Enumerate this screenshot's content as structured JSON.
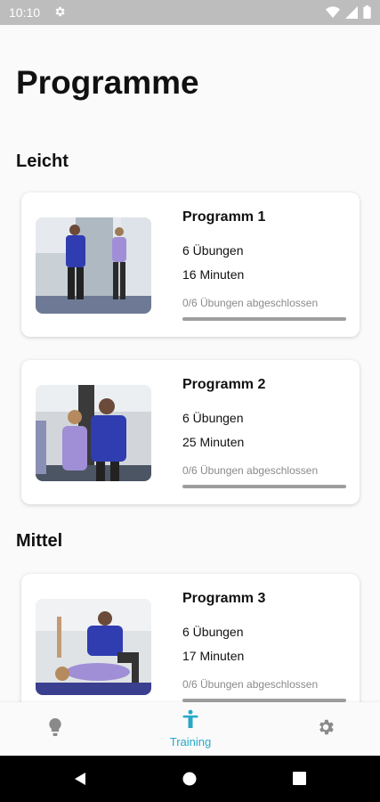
{
  "status_bar": {
    "time": "10:10"
  },
  "page": {
    "title": "Programme"
  },
  "sections": [
    {
      "label": "Leicht"
    },
    {
      "label": "Mittel"
    }
  ],
  "programs": [
    {
      "title": "Programm 1",
      "exercises": "6 Übungen",
      "duration": "16 Minuten",
      "progress_text": "0/6 Übungen abgeschlossen",
      "progress": 0
    },
    {
      "title": "Programm 2",
      "exercises": "6 Übungen",
      "duration": "25 Minuten",
      "progress_text": "0/6 Übungen abgeschlossen",
      "progress": 0
    },
    {
      "title": "Programm 3",
      "exercises": "6 Übungen",
      "duration": "17 Minuten",
      "progress_text": "0/6 Übungen abgeschlossen",
      "progress": 0
    }
  ],
  "bottom_nav": {
    "items": [
      {
        "icon": "lightbulb-icon",
        "label": ""
      },
      {
        "icon": "person-icon",
        "label": "Training",
        "active": true
      },
      {
        "icon": "settings-icon",
        "label": ""
      }
    ]
  },
  "colors": {
    "accent": "#26a9c9",
    "status_bar": "#bdbdbd",
    "background": "#fafafa"
  }
}
